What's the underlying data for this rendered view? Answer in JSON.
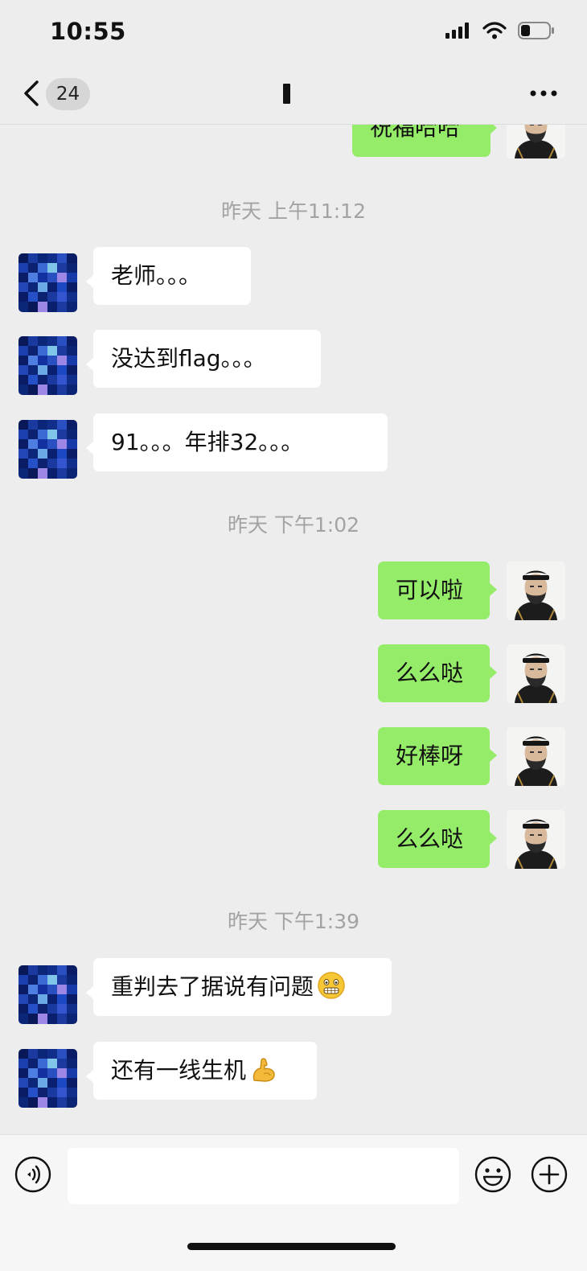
{
  "status": {
    "time": "10:55"
  },
  "nav": {
    "unread_count": "24"
  },
  "timestamps": [
    "昨天 上午11:12",
    "昨天 下午1:02",
    "昨天 下午1:39"
  ],
  "messages": {
    "top_partial": "祝福哈哈",
    "m1": "老师。。。",
    "m2": "没达到flag。。。",
    "m3": "91。。。年排32。。。",
    "m4": "可以啦",
    "m5": "么么哒",
    "m6": "好棒呀",
    "m7": "么么哒",
    "m8": "重判去了据说有问题",
    "m9": "还有一线生机"
  },
  "icons": {
    "m8_emoji": "grimacing-face-icon",
    "m9_emoji": "flexed-biceps-icon"
  },
  "colors": {
    "outgoing_bubble": "#95ec69",
    "incoming_bubble": "#ffffff",
    "background": "#ededed"
  }
}
